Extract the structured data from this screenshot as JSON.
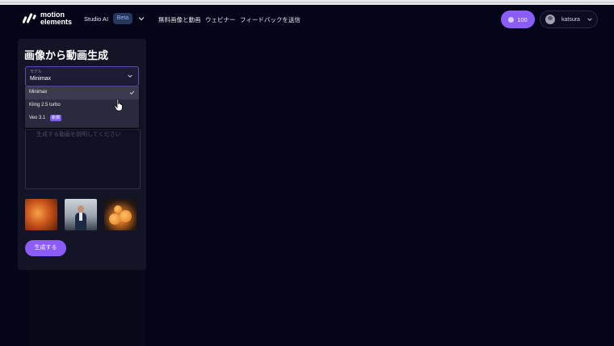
{
  "header": {
    "logo_line1": "motion",
    "logo_line2": "elements",
    "nav": {
      "studio_ai": "Studio AI",
      "beta": "Beta",
      "free_media": "無料画像と動画",
      "webinar": "ウェビナー",
      "feedback": "フィードバックを送信"
    },
    "credits": "100",
    "username": "katsura"
  },
  "panel": {
    "title": "画像から動画生成",
    "model_label": "モデル",
    "model_value": "Minimax",
    "options": [
      {
        "label": "Minimax",
        "selected": true
      },
      {
        "label": "Kling 2.5 turbo",
        "selected": false
      },
      {
        "label": "Veo 3.1",
        "selected": false,
        "badge": "新規"
      }
    ],
    "prompt_placeholder": "生成する動画を説明してください",
    "generate_label": "生成する"
  },
  "colors": {
    "accent": "#8b5cf6",
    "background": "#05051a",
    "panel": "#141427"
  }
}
